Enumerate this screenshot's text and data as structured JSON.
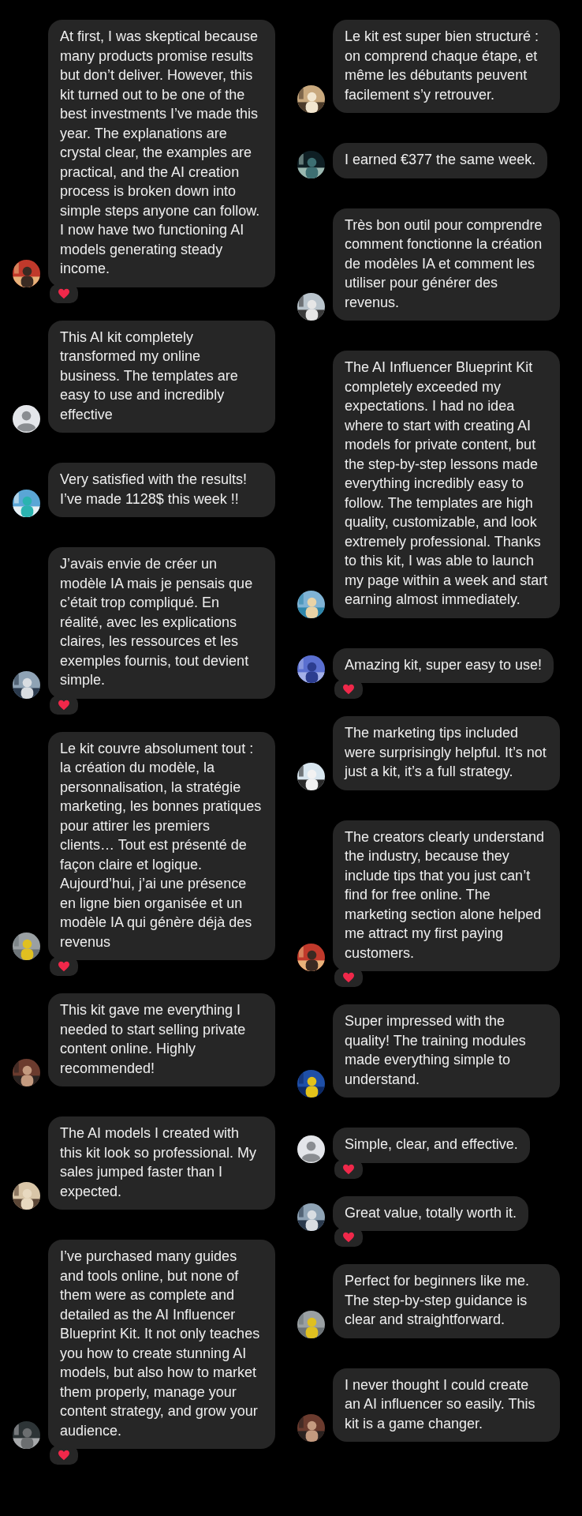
{
  "columns": [
    {
      "comments": [
        {
          "text": "At first, I was skeptical because many products promise results but don’t deliver. However, this kit turned out to be one of the best investments I’ve made this year. The explanations are crystal clear, the examples are practical, and the AI creation process is broken down into simple steps anyone can follow. I now have two functioning AI models generating steady income.",
          "reacted": true
        },
        {
          "avatar": {
            "kind": "default"
          },
          "text": "This AI kit completely transformed my online business. The templates are easy to use and incredibly effective",
          "reacted": false
        },
        {
          "text": "Very satisfied with the results! I’ve made 1128$ this week !!",
          "reacted": false
        },
        {
          "text": "J’avais envie de créer un modèle IA mais je pensais que c’était trop compliqué. En réalité, avec les explications claires, les ressources et les exemples fournis, tout devient simple.",
          "reacted": true
        },
        {
          "text": "Le kit couvre absolument tout : la création du modèle, la personnalisation, la stratégie marketing, les bonnes pratiques pour attirer les premiers clients… Tout est présenté de façon claire et logique. Aujourd’hui, j’ai une présence en ligne bien organisée et un modèle IA qui génère déjà des revenus",
          "reacted": true
        },
        {
          "text": "This kit gave me everything I needed to start selling private content online. Highly recommended!",
          "reacted": false
        },
        {
          "text": "The AI models I created with this kit look so professional. My sales jumped faster than I expected.",
          "reacted": false
        },
        {
          "text": "I’ve purchased many guides and tools online, but none of them were as complete and detailed as the AI Influencer Blueprint Kit. It not only teaches you how to create stunning AI models, but also how to market them properly, manage your content strategy, and grow your audience.",
          "reacted": true
        }
      ]
    },
    {
      "comments": [
        {
          "text": "Le kit est super bien structuré : on comprend chaque étape, et même les débutants peuvent facilement s’y retrouver.",
          "reacted": false
        },
        {
          "text": "I earned €377 the same week.",
          "reacted": false
        },
        {
          "text": "Très bon outil pour comprendre comment fonctionne la création de modèles IA et comment les utiliser pour générer des revenus.",
          "reacted": false
        },
        {
          "text": "The AI Influencer Blueprint Kit completely exceeded my expectations. I had no idea where to start with creating AI models for private content, but the step-by-step lessons made everything incredibly easy to follow. The templates are high quality, customizable, and look extremely professional. Thanks to this kit, I was able to launch my page within a week and start earning almost immediately.",
          "reacted": false
        },
        {
          "text": "Amazing kit, super easy to use!",
          "reacted": true
        },
        {
          "text": "The marketing tips included were surprisingly helpful. It’s not just a kit, it’s a full strategy.",
          "reacted": false
        },
        {
          "text": "The creators clearly understand the industry, because they include tips that you just can’t find for free online. The marketing section alone helped me attract my first paying customers.",
          "reacted": true
        },
        {
          "text": "Super impressed with the quality! The training modules made everything simple to understand.",
          "reacted": false
        },
        {
          "avatar": {
            "kind": "default"
          },
          "text": "Simple, clear, and effective.",
          "reacted": true
        },
        {
          "text": "Great value, totally worth it.",
          "reacted": true
        },
        {
          "text": "Perfect for beginners like me. The step-by-step guidance is clear and straightforward.",
          "reacted": false
        },
        {
          "text": "I never thought I could create an AI influencer so easily. This kit is a game changer.",
          "reacted": false
        }
      ]
    }
  ]
}
